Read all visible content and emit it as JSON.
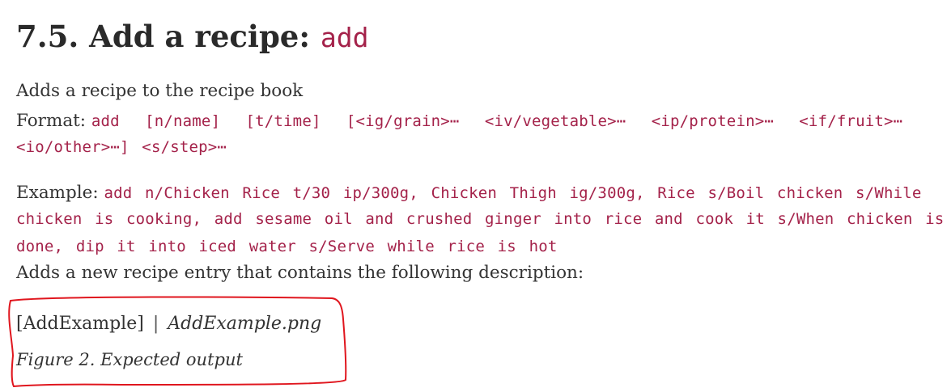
{
  "heading": {
    "number_title": "7.5. Add a recipe:",
    "command": "add"
  },
  "description": "Adds a recipe to the recipe book",
  "format": {
    "label": "Format:",
    "line1": "add  [n/name]  [t/time]  [<ig/grain>⋯  <iv/vegetable>⋯  <ip/protein>⋯  <if/fruit>⋯",
    "line2": "<io/other>⋯] <s/step>⋯"
  },
  "example": {
    "label": "Example:",
    "line1": "add n/Chicken Rice t/30 ip/300g, Chicken Thigh ig/300g, Rice s/Boil chicken s/While",
    "line2": "chicken is cooking, add sesame oil and crushed ginger into rice and cook it s/When chicken is",
    "line3": "done, dip it into iced water s/Serve while rice is hot"
  },
  "result_text": "Adds a new recipe entry that contains the following description:",
  "figure": {
    "image_alt": "[AddExample]",
    "separator": "|",
    "image_file": "AddExample.png",
    "caption": "Figure 2. Expected output"
  },
  "annotation_color": "#e0161e"
}
